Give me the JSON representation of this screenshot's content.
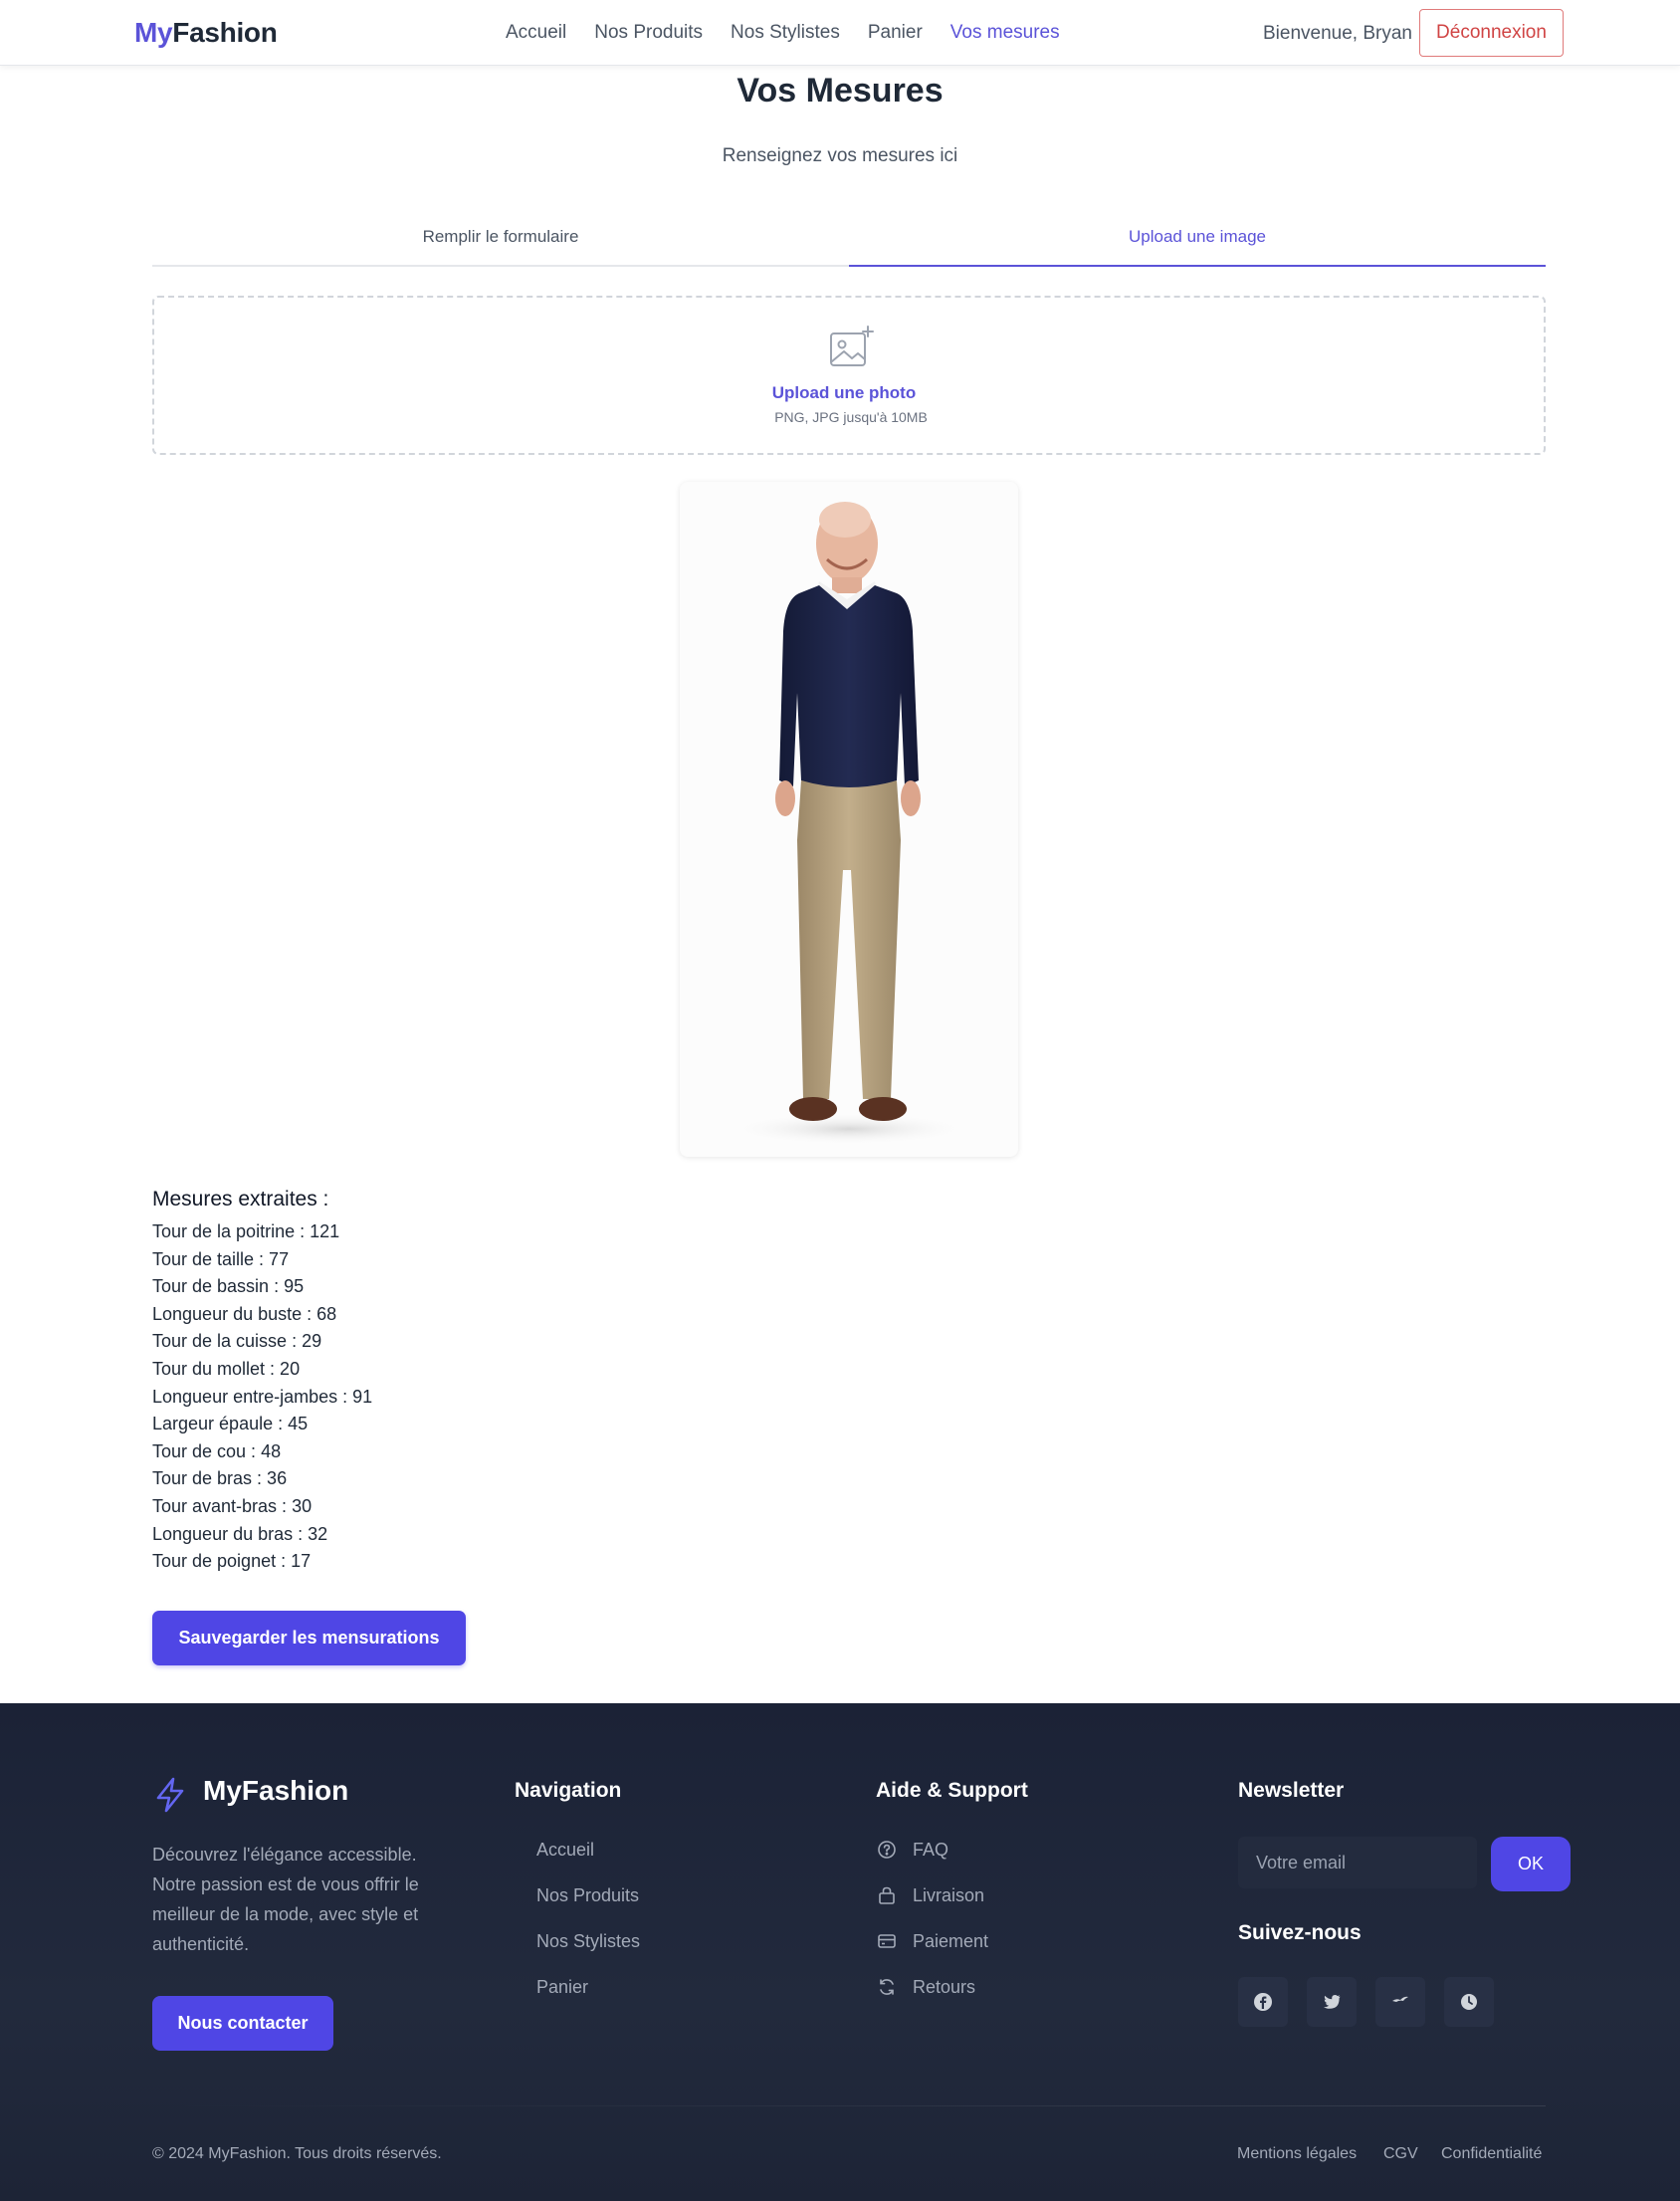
{
  "header": {
    "logo_my": "My",
    "logo_fashion": "Fashion",
    "nav": [
      "Accueil",
      "Nos Produits",
      "Nos Stylistes",
      "Panier",
      "Vos mesures"
    ],
    "active_nav": "Vos mesures",
    "welcome": "Bienvenue, Bryan",
    "logout": "Déconnexion"
  },
  "main": {
    "title": "Vos Mesures",
    "subtitle": "Renseignez vos mesures ici",
    "tabs": [
      "Remplir le formulaire",
      "Upload une image"
    ],
    "active_tab": "Upload une image",
    "upload": {
      "icon": "image-plus-icon",
      "title": "Upload une photo",
      "hint": "PNG, JPG jusqu'à 10MB"
    },
    "results_title": "Mesures extraites :",
    "measurements": [
      "Tour de la poitrine : 121",
      "Tour de taille : 77",
      "Tour de bassin : 95",
      "Longueur du buste : 68",
      "Tour de la cuisse : 29",
      "Tour du mollet : 20",
      "Longueur entre-jambes : 91",
      "Largeur épaule : 45",
      "Tour de cou : 48",
      "Tour de bras : 36",
      "Tour avant-bras : 30",
      "Longueur du bras : 32",
      "Tour de poignet : 17"
    ],
    "save_button": "Sauvegarder les mensurations"
  },
  "footer": {
    "brand": "MyFashion",
    "description": "Découvrez l'élégance accessible. Notre passion est de vous offrir le meilleur de la mode, avec style et authenticité.",
    "contact_button": "Nous contacter",
    "navigation_title": "Navigation",
    "navigation": [
      "Accueil",
      "Nos Produits",
      "Nos Stylistes",
      "Panier"
    ],
    "support_title": "Aide & Support",
    "support": [
      {
        "label": "FAQ",
        "icon": "help-circle-icon"
      },
      {
        "label": "Livraison",
        "icon": "bag-icon"
      },
      {
        "label": "Paiement",
        "icon": "credit-card-icon"
      },
      {
        "label": "Retours",
        "icon": "refresh-icon"
      }
    ],
    "newsletter_title": "Newsletter",
    "newsletter_placeholder": "Votre email",
    "newsletter_button": "OK",
    "follow_title": "Suivez-nous",
    "socials": [
      "facebook-icon",
      "twitter-icon",
      "bird-icon",
      "clock-icon"
    ],
    "copyright": "© 2024 MyFashion. Tous droits réservés.",
    "legal": [
      "Mentions légales",
      "CGV",
      "Confidentialité"
    ]
  },
  "colors": {
    "accent": "#5b53d8",
    "button": "#4f46e5",
    "logout": "#d04444",
    "footer_bg": "#1f2638"
  }
}
